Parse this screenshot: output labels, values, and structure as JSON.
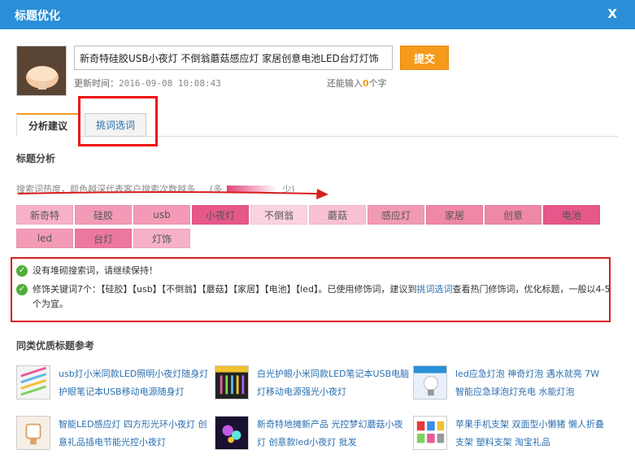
{
  "window": {
    "title": "标题优化",
    "close_label": "X"
  },
  "product": {
    "title_value": "新奇特硅胶USB小夜灯 不倒翁蘑菇感应灯 家居创意电池LED台灯灯饰",
    "submit_label": "提交",
    "update_label": "更新时间：",
    "update_time": "2016-09-08 10:08:43",
    "remain_prefix": "还能输入",
    "remain_count": "0",
    "remain_suffix": "个字"
  },
  "tabs": [
    {
      "label": "分析建议",
      "active": true
    },
    {
      "label": "挑词选词",
      "active": false
    }
  ],
  "analysis": {
    "heading": "标题分析",
    "hint": "搜索词热度，颜色越深代表客户搜索次数越多",
    "legend_many": "(多",
    "legend_few": "少)",
    "keywords": [
      {
        "label": "新奇特",
        "color": "#f7b1c6"
      },
      {
        "label": "硅胶",
        "color": "#f39bb6"
      },
      {
        "label": "usb",
        "color": "#f39bb6"
      },
      {
        "label": "小夜灯",
        "color": "#e6578a"
      },
      {
        "label": "不倒翁",
        "color": "#fad3df"
      },
      {
        "label": "蘑菇",
        "color": "#f8c1d1"
      },
      {
        "label": "感应灯",
        "color": "#f29ab4"
      },
      {
        "label": "家居",
        "color": "#ef87a7"
      },
      {
        "label": "创意",
        "color": "#ef87a7"
      },
      {
        "label": "电池",
        "color": "#e6578a"
      },
      {
        "label": "led",
        "color": "#f39bb6"
      },
      {
        "label": "台灯",
        "color": "#ec789d"
      },
      {
        "label": "灯饰",
        "color": "#f7b1c6"
      }
    ]
  },
  "suggestions": {
    "line1": "没有堆砌搜索词，请继续保持！",
    "line2_before": "修饰关键词7个：【硅胶】【usb】【不倒翁】【蘑菇】【家居】【电池】【led】。已使用修饰词，建议到",
    "line2_link": "挑词选词",
    "line2_after": "查看热门修饰词，优化标题，一般以4-5个为宜。"
  },
  "references": {
    "heading": "同类优质标题参考",
    "items": [
      {
        "text": "usb灯小米同款LED照明小夜灯随身灯护眼笔记本USB移动电源随身灯"
      },
      {
        "text": "白光护眼小米同款LED笔记本USB电脑灯移动电源强光小夜灯"
      },
      {
        "text": "led应急灯泡 神奇灯泡 遇水就亮 7W智能应急球泡灯充电 水能灯泡"
      },
      {
        "text": "智能LED感应灯 四方形光环小夜灯 创意礼品插电节能光控小夜灯"
      },
      {
        "text": "新奇特地摊新产品 光控梦幻蘑菇小夜灯 创意款led小夜灯 批发"
      },
      {
        "text": "苹果手机支架 双面型小懒猪 懒人折叠支架 塑料支架 淘宝礼品"
      }
    ]
  },
  "colors": {
    "titlebar": "#2a8fd8",
    "accent": "#f59a1b",
    "highlight_border": "#e11111",
    "link": "#2a6fb0"
  }
}
